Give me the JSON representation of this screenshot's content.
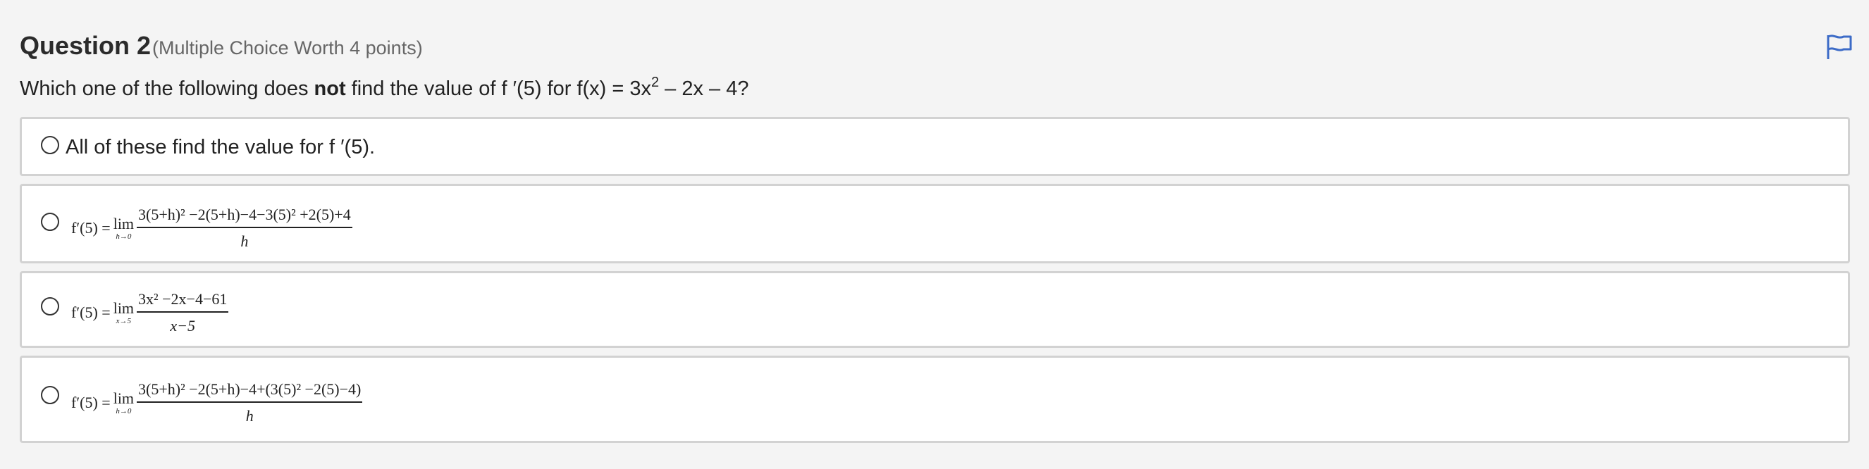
{
  "question": {
    "title": "Question 2",
    "worth": "(Multiple Choice Worth 4 points)",
    "prompt_before": "Which one of the following does ",
    "prompt_bold": "not",
    "prompt_after": " find the value of f ′(5) for f(x) = 3x",
    "prompt_exp": "2",
    "prompt_end": " – 2x – 4?"
  },
  "flag_icon": "flag-outline-icon",
  "accent_color": "#3c6bc7",
  "options": [
    {
      "text": "All of these find the value for f ′(5)."
    },
    {
      "lhs": "f′(5) = ",
      "lim": "lim",
      "lim_sub": "h→0",
      "numerator": "3(5+h)² −2(5+h)−4−3(5)² +2(5)+4",
      "denominator": "h"
    },
    {
      "lhs": "f′(5) = ",
      "lim": "lim",
      "lim_sub": "x→5",
      "numerator": "3x² −2x−4−61",
      "denominator": "x−5"
    },
    {
      "lhs": "f′(5) = ",
      "lim": "lim",
      "lim_sub": "h→0",
      "numerator": "3(5+h)² −2(5+h)−4+(3(5)² −2(5)−4)",
      "denominator": "h"
    }
  ]
}
